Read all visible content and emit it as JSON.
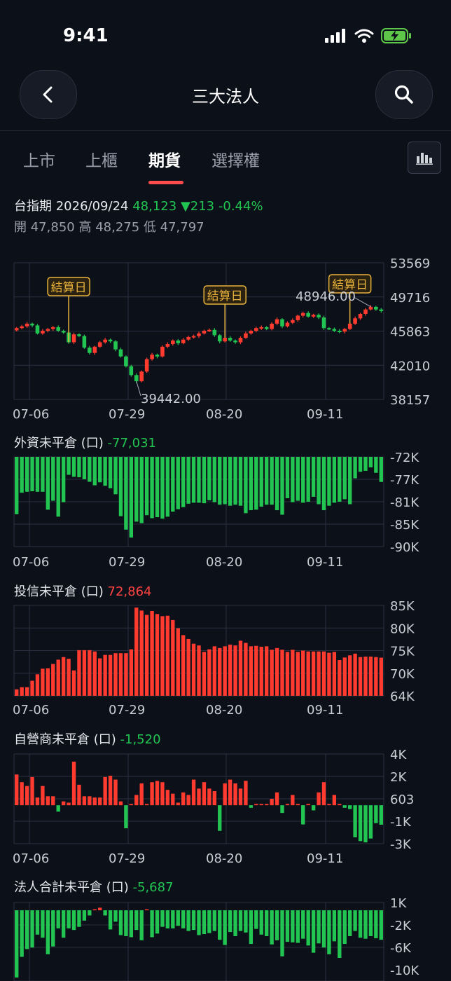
{
  "status_bar": {
    "time": "9:41",
    "icons": [
      "signal-icon",
      "wifi-icon",
      "battery-charging-icon"
    ]
  },
  "header": {
    "back_icon": "chevron-left-icon",
    "title": "三大法人",
    "search_icon": "search-icon"
  },
  "tabs": [
    {
      "label": "上市",
      "active": false
    },
    {
      "label": "上櫃",
      "active": false
    },
    {
      "label": "期貨",
      "active": true
    },
    {
      "label": "選擇權",
      "active": false
    }
  ],
  "tab_action_icon": "bar-chart-icon",
  "quote": {
    "name": "台指期",
    "date": "2026/09/24",
    "price": "48,123",
    "change": "▼213",
    "change_pct": "-0.44%",
    "open_label": "開",
    "open": "47,850",
    "high_label": "高",
    "high": "48,275",
    "low_label": "低",
    "low": "47,797"
  },
  "x_tick_labels": [
    "07-06",
    "07-29",
    "08-20",
    "09-11"
  ],
  "colors": {
    "up": "#ff3b30",
    "down": "#23c552",
    "marker": "#e8b33c",
    "grid": "#2a3040"
  },
  "chart_data": [
    {
      "type": "candlestick",
      "name": "台指期",
      "y_ticks": [
        "53569",
        "49716",
        "45863",
        "42010",
        "38157"
      ],
      "ylim": [
        38157,
        53569
      ],
      "close": [
        46200,
        46400,
        46700,
        46500,
        45600,
        45900,
        46100,
        46300,
        45900,
        45700,
        44600,
        45500,
        45300,
        44000,
        43400,
        44100,
        44600,
        44900,
        44700,
        43800,
        43000,
        41900,
        40900,
        40200,
        41300,
        42700,
        43200,
        43000,
        44100,
        44400,
        44800,
        44500,
        44900,
        45200,
        45300,
        45600,
        45900,
        46000,
        45400,
        44700,
        45100,
        44800,
        44600,
        45100,
        45600,
        45900,
        46200,
        46300,
        46100,
        46700,
        47200,
        46400,
        46800,
        47100,
        47600,
        47900,
        47500,
        47700,
        47400,
        46200,
        46100,
        45900,
        45800,
        46100,
        46700,
        47300,
        47800,
        48300,
        48600,
        48300,
        48123
      ],
      "lowest_label": "39442.00",
      "highest_label": "48946.00",
      "settlement_label": "結算日",
      "settlement_indices": [
        10,
        40,
        64
      ]
    },
    {
      "type": "bar",
      "title": "外資未平倉 (口)",
      "latest": "-77,031",
      "latest_color": "green",
      "y_ticks": [
        "-72K",
        "-77K",
        "-81K",
        "-85K",
        "-90K"
      ],
      "ylim": [
        -90000,
        -72000
      ],
      "base": "top",
      "values": [
        -83500,
        -79200,
        -79000,
        -78900,
        -79000,
        -79000,
        -82600,
        -80800,
        -84000,
        -81100,
        -75600,
        -76000,
        -76100,
        -76500,
        -77000,
        -77700,
        -77100,
        -77800,
        -78300,
        -79500,
        -83900,
        -86600,
        -88200,
        -85000,
        -85300,
        -83700,
        -84300,
        -84100,
        -84400,
        -84000,
        -83000,
        -82500,
        -82100,
        -81400,
        -81200,
        -81200,
        -81300,
        -80700,
        -81100,
        -81600,
        -81500,
        -81800,
        -81600,
        -81800,
        -83300,
        -82700,
        -82600,
        -82000,
        -81600,
        -81600,
        -82700,
        -83600,
        -80300,
        -81100,
        -80800,
        -81200,
        -81000,
        -80000,
        -81500,
        -82700,
        -81800,
        -81200,
        -81000,
        -80500,
        -81500,
        -76300,
        -75000,
        -74800,
        -74100,
        -75200,
        -77031
      ]
    },
    {
      "type": "bar",
      "title": "投信未平倉 (口)",
      "latest": "72,864",
      "latest_color": "red",
      "y_ticks": [
        "85K",
        "80K",
        "75K",
        "70K",
        "64K"
      ],
      "ylim": [
        64000,
        85000
      ],
      "base": "bottom",
      "values": [
        65500,
        66000,
        66000,
        67500,
        69000,
        70300,
        70400,
        71400,
        72400,
        73000,
        72600,
        69900,
        74600,
        74600,
        74600,
        74300,
        72700,
        73500,
        73500,
        73900,
        73900,
        73900,
        74800,
        84500,
        83800,
        82800,
        83700,
        83000,
        82500,
        82600,
        81600,
        79700,
        78100,
        77200,
        76100,
        75700,
        74200,
        74800,
        75500,
        75100,
        75500,
        75900,
        75700,
        76800,
        76300,
        75500,
        75600,
        75400,
        75500,
        74700,
        75100,
        74700,
        74200,
        74700,
        74200,
        74500,
        74300,
        74300,
        74300,
        74300,
        74000,
        74200,
        72300,
        72900,
        73400,
        73800,
        73000,
        73100,
        73100,
        73000,
        72864
      ]
    },
    {
      "type": "bar",
      "title": "自營商未平倉 (口)",
      "latest": "-1,520",
      "latest_color": "green",
      "y_ticks": [
        "4K",
        "2K",
        "603",
        "-1K",
        "-3K"
      ],
      "ylim": [
        -3000,
        4000
      ],
      "base": "zero",
      "values": [
        2400,
        1800,
        1500,
        2200,
        600,
        1500,
        700,
        700,
        -500,
        300,
        200,
        3400,
        1600,
        700,
        700,
        600,
        600,
        2200,
        2300,
        2000,
        300,
        -1800,
        100,
        800,
        1700,
        100,
        1800,
        1900,
        1800,
        1200,
        900,
        200,
        1000,
        800,
        2000,
        1300,
        1800,
        1300,
        1100,
        -2000,
        1700,
        2000,
        1700,
        1300,
        1900,
        -200,
        100,
        100,
        100,
        500,
        1000,
        -600,
        100,
        800,
        100,
        -1500,
        100,
        -400,
        1000,
        1800,
        100,
        800,
        100,
        -200,
        -300,
        -2500,
        -2800,
        -2900,
        -2600,
        -1400,
        -1520
      ]
    },
    {
      "type": "bar",
      "title": "法人合計未平倉 (口)",
      "latest": "-5,687",
      "latest_color": "green",
      "y_ticks": [
        "1K",
        "-2K",
        "-6K",
        "-10K"
      ],
      "ylim": [
        -11500,
        1500
      ],
      "base": "zero",
      "values": [
        -13000,
        -9000,
        -7500,
        -7200,
        -4700,
        -5300,
        -8500,
        -7000,
        -3500,
        -5300,
        -3500,
        -3800,
        -3200,
        -2000,
        -1000,
        200,
        500,
        -1000,
        -3700,
        -2200,
        -4800,
        -5000,
        -5200,
        -3800,
        -5800,
        200,
        -5200,
        -4500,
        -3200,
        -3500,
        -3500,
        -3000,
        -3500,
        -4000,
        -3800,
        -4800,
        -4600,
        -4400,
        -4000,
        -5700,
        -6700,
        -4200,
        -5000,
        -4000,
        -4300,
        -6500,
        -3600,
        -4700,
        -5000,
        -6600,
        -5800,
        -8900,
        -6100,
        -6200,
        -6300,
        -5500,
        -6800,
        -8200,
        -6400,
        -7200,
        -8500,
        -6000,
        -9200,
        -6500,
        -5000,
        -4000,
        -5300,
        -5500,
        -5000,
        -5400,
        -5687
      ]
    }
  ]
}
